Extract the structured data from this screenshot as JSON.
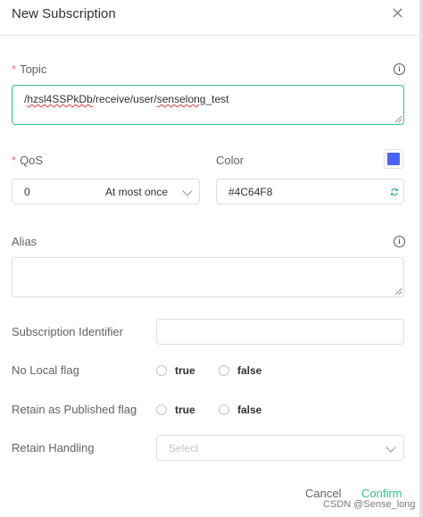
{
  "dialog": {
    "title": "New Subscription",
    "close_icon": "✕"
  },
  "topic": {
    "label": "Topic",
    "required_mark": "*",
    "value_part1": "/",
    "value_part2": "hzsl4SSPkDb",
    "value_part3": "/receive/user/",
    "value_part4": "senselong",
    "value_part5": "_test"
  },
  "qos": {
    "label": "QoS",
    "required_mark": "*",
    "value": "0",
    "value_text": "At most once"
  },
  "color": {
    "label": "Color",
    "value": "#4C64F8",
    "swatch_color": "#4C64F8",
    "refresh_icon": "refresh-icon"
  },
  "alias": {
    "label": "Alias",
    "value": ""
  },
  "subscription_identifier": {
    "label": "Subscription Identifier",
    "value": ""
  },
  "no_local": {
    "label": "No Local flag",
    "options": [
      "true",
      "false"
    ]
  },
  "retain_as_published": {
    "label": "Retain as Published flag",
    "options": [
      "true",
      "false"
    ]
  },
  "retain_handling": {
    "label": "Retain Handling",
    "placeholder": "Select"
  },
  "footer": {
    "cancel_label": "Cancel",
    "confirm_label": "Confirm"
  },
  "watermark": "CSDN @Sense_long",
  "colors": {
    "accent": "#34c388",
    "required": "#f56c6c"
  }
}
